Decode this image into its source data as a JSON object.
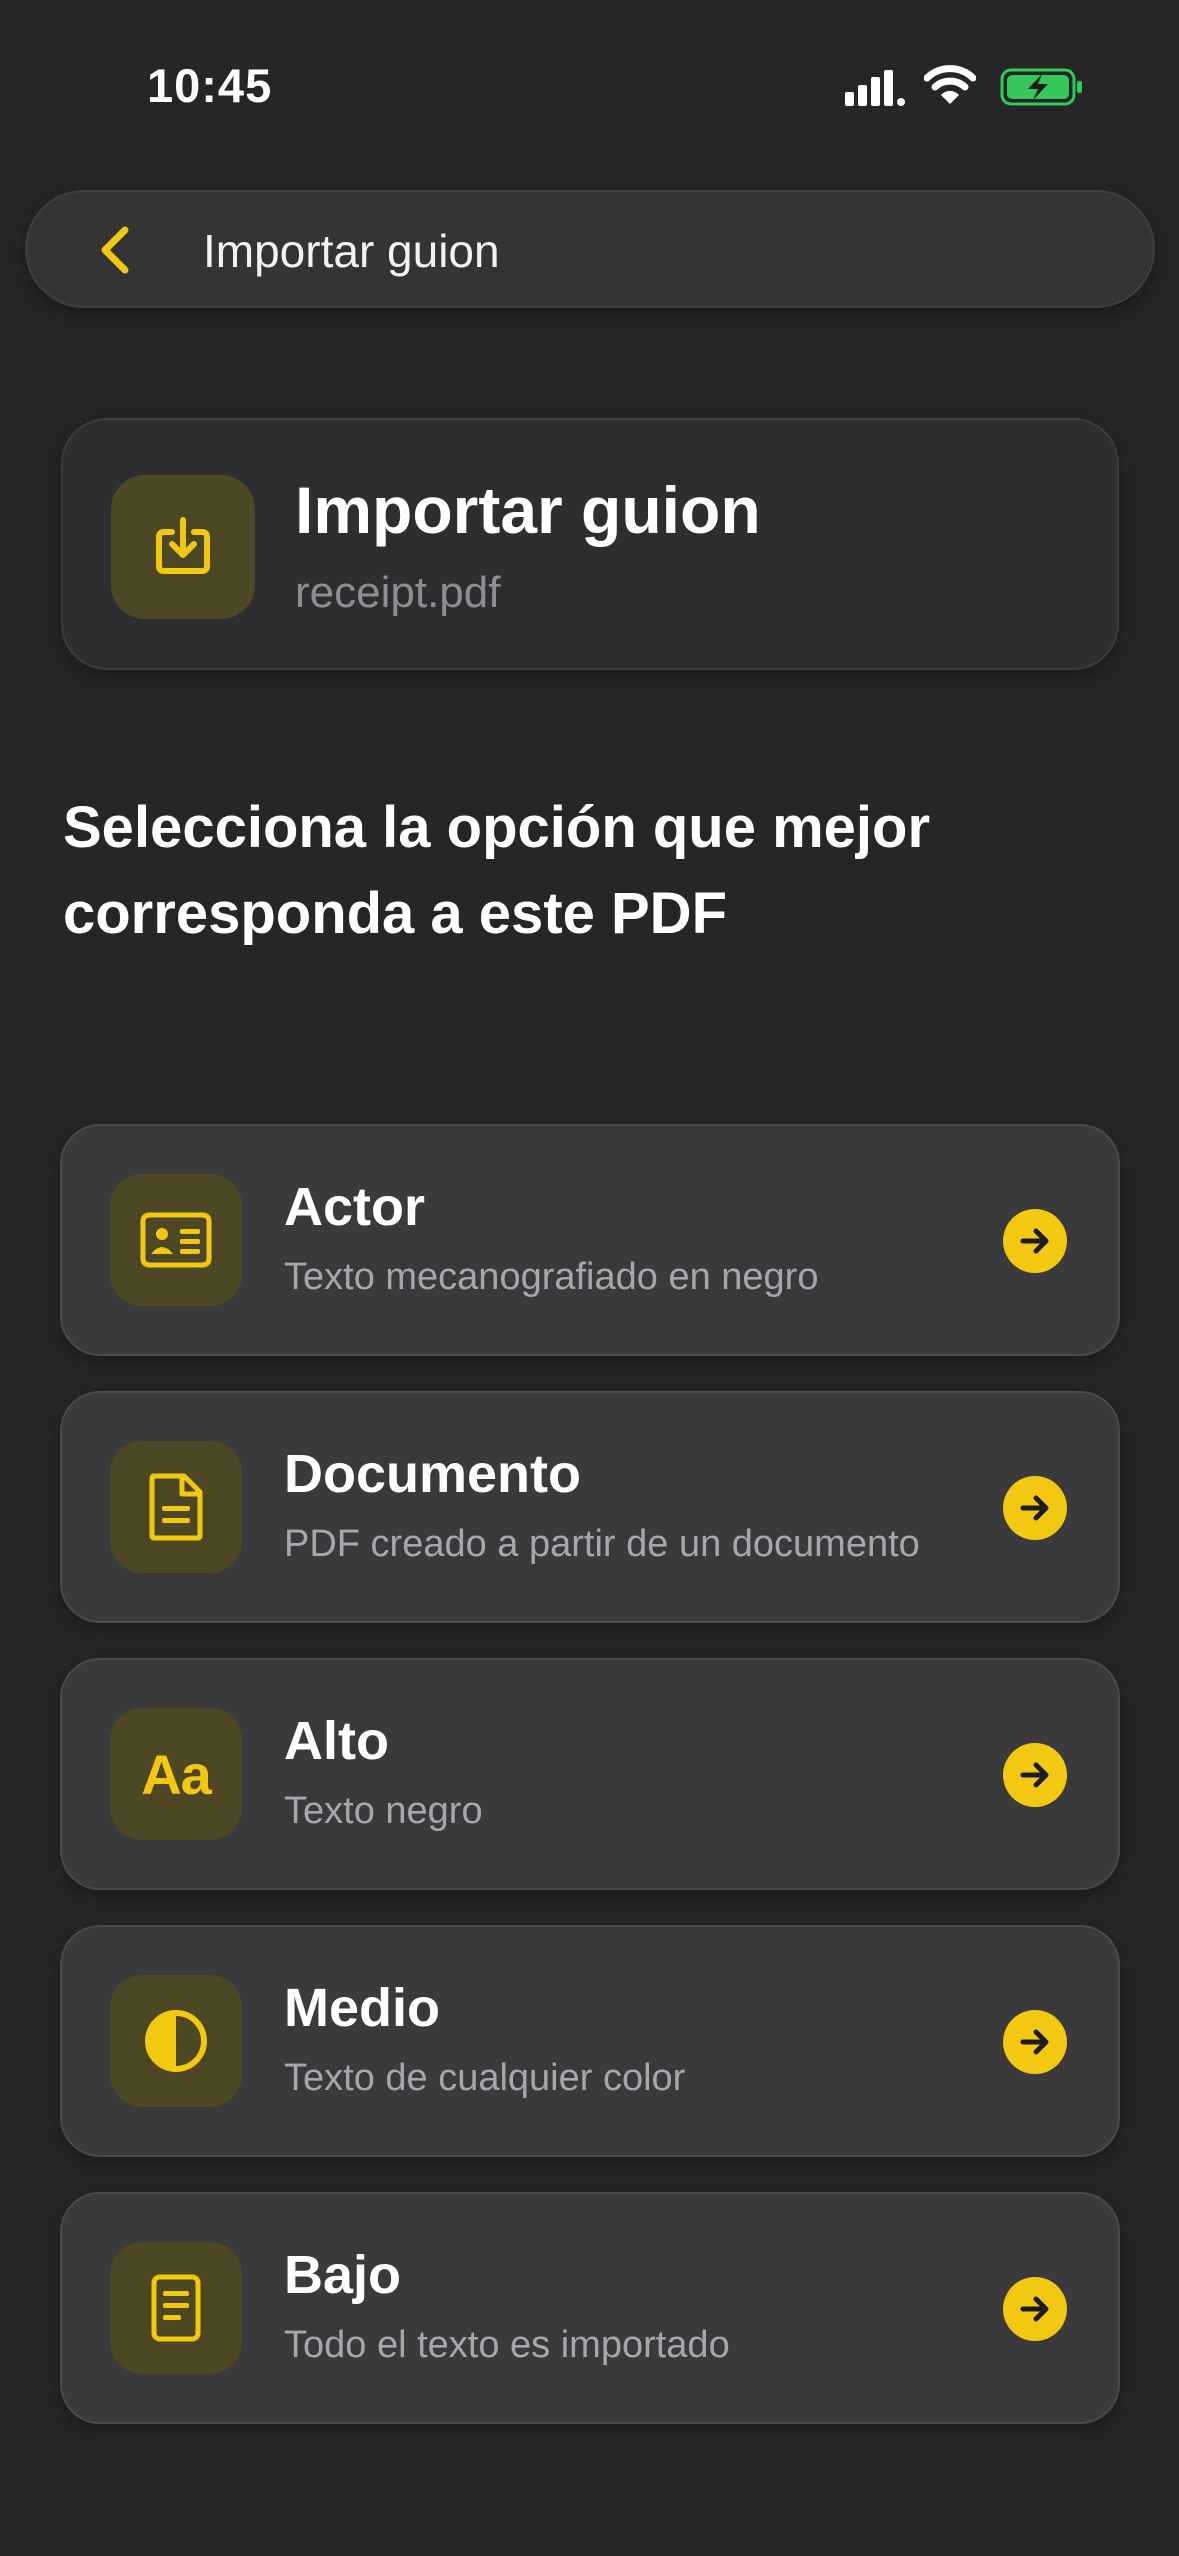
{
  "status_bar": {
    "time": "10:45",
    "icons": [
      "cellular-signal-icon",
      "wifi-icon",
      "battery-charging-icon"
    ],
    "battery_color": "#34c759"
  },
  "nav": {
    "back_icon": "chevron-left-icon",
    "title": "Importar guion"
  },
  "file_card": {
    "icon": "download-tray-icon",
    "title": "Importar guion",
    "file_name": "receipt.pdf"
  },
  "prompt": "Selecciona la opción que mejor corresponda a este PDF",
  "options": [
    {
      "icon": "id-card-icon",
      "title": "Actor",
      "subtitle": "Texto mecanografiado en negro"
    },
    {
      "icon": "document-icon",
      "title": "Documento",
      "subtitle": "PDF creado a partir de un documento"
    },
    {
      "icon": "text-size-icon",
      "icon_text": "Aa",
      "title": "Alto",
      "subtitle": "Texto negro"
    },
    {
      "icon": "contrast-icon",
      "title": "Medio",
      "subtitle": "Texto de cualquier color"
    },
    {
      "icon": "note-icon",
      "title": "Bajo",
      "subtitle": "Todo el texto es importado"
    }
  ],
  "colors": {
    "background": "#262628",
    "accent": "#f2c811",
    "card": "#3a3a3c",
    "icon_tile": "#4d4823"
  }
}
